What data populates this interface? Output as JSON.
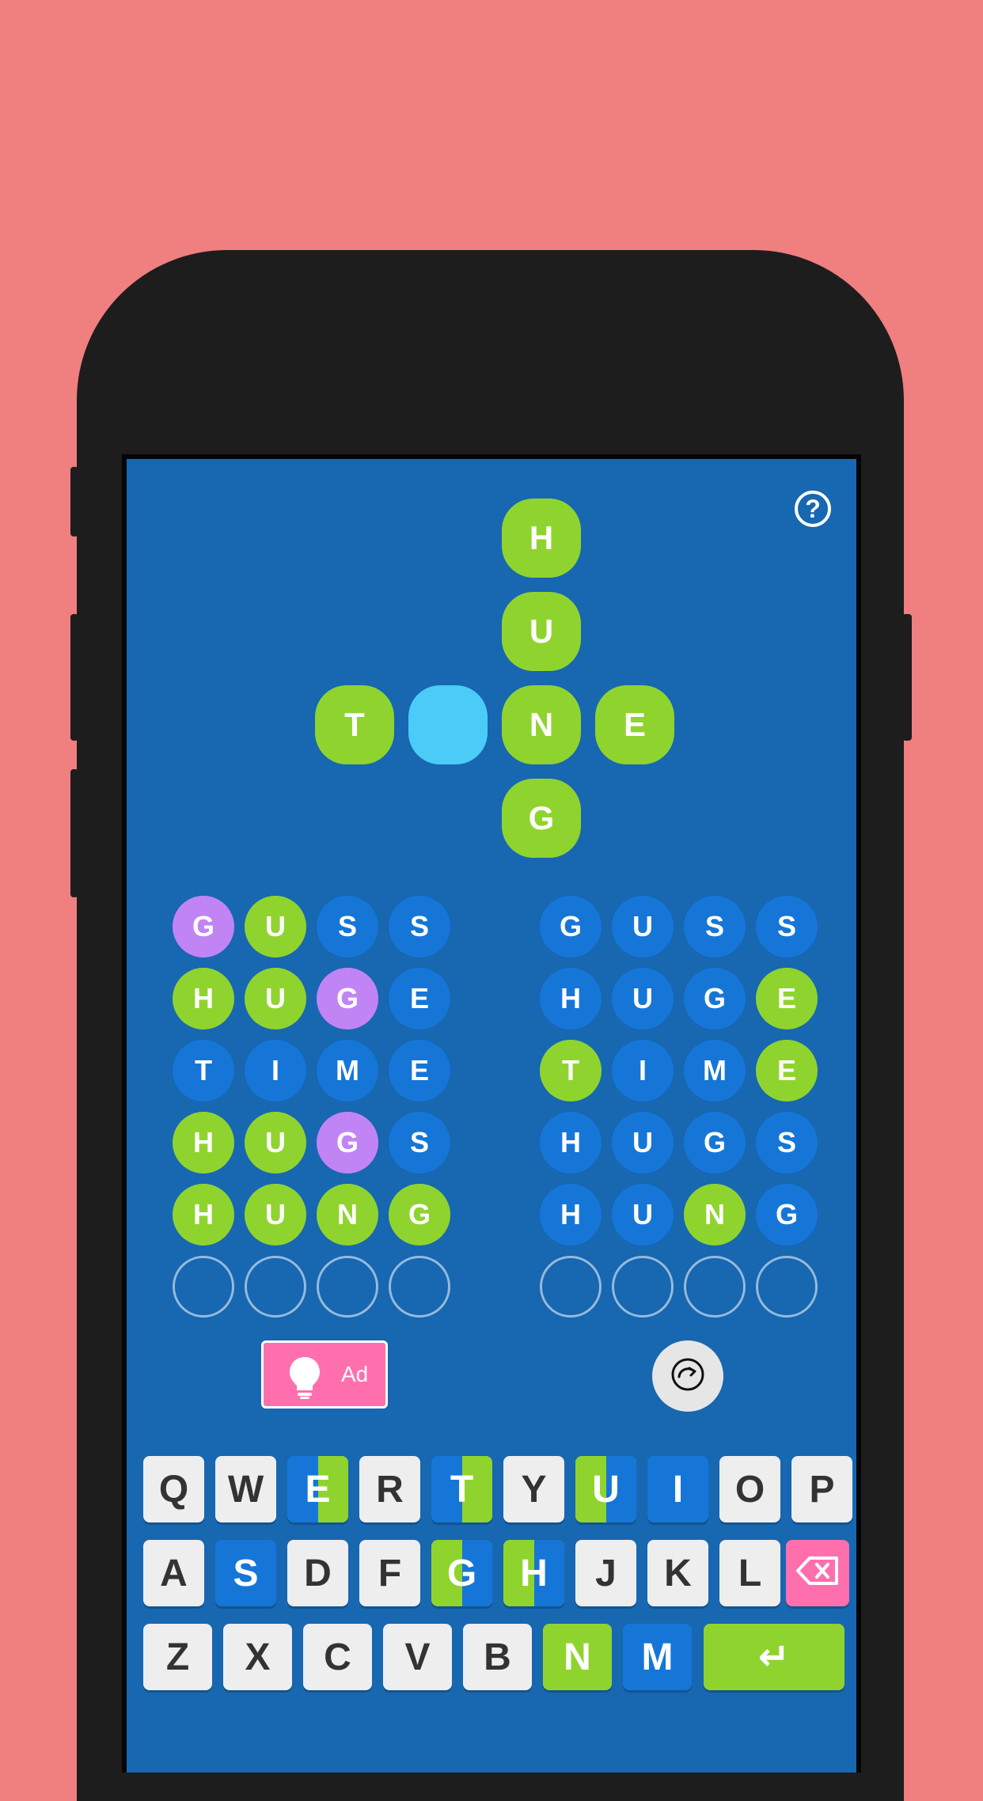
{
  "colors": {
    "background": "#f07f7f",
    "screen": "#1767b1",
    "green": "#8fd42e",
    "blue": "#1676d8",
    "purple": "#c184f5",
    "cyan": "#4bcbf7",
    "pink": "#ff6fae"
  },
  "help": {
    "icon": "help-icon",
    "label": "?"
  },
  "crossword": {
    "vertical": [
      "H",
      "U",
      "N",
      "G"
    ],
    "horizontal": [
      "T",
      "",
      "N",
      "E"
    ]
  },
  "left_board": [
    [
      {
        "l": "G",
        "s": "purple"
      },
      {
        "l": "U",
        "s": "green"
      },
      {
        "l": "S",
        "s": "blue"
      },
      {
        "l": "S",
        "s": "blue"
      }
    ],
    [
      {
        "l": "H",
        "s": "green"
      },
      {
        "l": "U",
        "s": "green"
      },
      {
        "l": "G",
        "s": "purple"
      },
      {
        "l": "E",
        "s": "blue"
      }
    ],
    [
      {
        "l": "T",
        "s": "blue"
      },
      {
        "l": "I",
        "s": "blue"
      },
      {
        "l": "M",
        "s": "blue"
      },
      {
        "l": "E",
        "s": "blue"
      }
    ],
    [
      {
        "l": "H",
        "s": "green"
      },
      {
        "l": "U",
        "s": "green"
      },
      {
        "l": "G",
        "s": "purple"
      },
      {
        "l": "S",
        "s": "blue"
      }
    ],
    [
      {
        "l": "H",
        "s": "green"
      },
      {
        "l": "U",
        "s": "green"
      },
      {
        "l": "N",
        "s": "green"
      },
      {
        "l": "G",
        "s": "green"
      }
    ],
    [
      {
        "l": "",
        "s": "empty"
      },
      {
        "l": "",
        "s": "empty"
      },
      {
        "l": "",
        "s": "empty"
      },
      {
        "l": "",
        "s": "empty"
      }
    ]
  ],
  "right_board": [
    [
      {
        "l": "G",
        "s": "blue"
      },
      {
        "l": "U",
        "s": "blue"
      },
      {
        "l": "S",
        "s": "blue"
      },
      {
        "l": "S",
        "s": "blue"
      }
    ],
    [
      {
        "l": "H",
        "s": "blue"
      },
      {
        "l": "U",
        "s": "blue"
      },
      {
        "l": "G",
        "s": "blue"
      },
      {
        "l": "E",
        "s": "green"
      }
    ],
    [
      {
        "l": "T",
        "s": "green"
      },
      {
        "l": "I",
        "s": "blue"
      },
      {
        "l": "M",
        "s": "blue"
      },
      {
        "l": "E",
        "s": "green"
      }
    ],
    [
      {
        "l": "H",
        "s": "blue"
      },
      {
        "l": "U",
        "s": "blue"
      },
      {
        "l": "G",
        "s": "blue"
      },
      {
        "l": "S",
        "s": "blue"
      }
    ],
    [
      {
        "l": "H",
        "s": "blue"
      },
      {
        "l": "U",
        "s": "blue"
      },
      {
        "l": "N",
        "s": "green"
      },
      {
        "l": "G",
        "s": "blue"
      }
    ],
    [
      {
        "l": "",
        "s": "empty"
      },
      {
        "l": "",
        "s": "empty"
      },
      {
        "l": "",
        "s": "empty"
      },
      {
        "l": "",
        "s": "empty"
      }
    ]
  ],
  "hint_button": {
    "icon": "lightbulb-icon",
    "label": "Ad"
  },
  "restart_button": {
    "icon": "restart-icon"
  },
  "keyboard": {
    "row1": [
      {
        "k": "Q",
        "s": "light"
      },
      {
        "k": "W",
        "s": "light"
      },
      {
        "k": "E",
        "s": "blue-green"
      },
      {
        "k": "R",
        "s": "light"
      },
      {
        "k": "T",
        "s": "blue-green"
      },
      {
        "k": "Y",
        "s": "light"
      },
      {
        "k": "U",
        "s": "green-blue"
      },
      {
        "k": "I",
        "s": "blue"
      },
      {
        "k": "O",
        "s": "light"
      },
      {
        "k": "P",
        "s": "light"
      }
    ],
    "row2": [
      {
        "k": "A",
        "s": "light"
      },
      {
        "k": "S",
        "s": "blue"
      },
      {
        "k": "D",
        "s": "light"
      },
      {
        "k": "F",
        "s": "light"
      },
      {
        "k": "G",
        "s": "green-blue"
      },
      {
        "k": "H",
        "s": "green-blue"
      },
      {
        "k": "J",
        "s": "light"
      },
      {
        "k": "K",
        "s": "light"
      },
      {
        "k": "L",
        "s": "light"
      }
    ],
    "row3": [
      {
        "k": "Z",
        "s": "light"
      },
      {
        "k": "X",
        "s": "light"
      },
      {
        "k": "C",
        "s": "light"
      },
      {
        "k": "V",
        "s": "light"
      },
      {
        "k": "B",
        "s": "light"
      },
      {
        "k": "N",
        "s": "green"
      },
      {
        "k": "M",
        "s": "blue"
      }
    ],
    "backspace_icon": "backspace-icon",
    "enter_label": "↵",
    "enter_icon": "enter-icon"
  }
}
